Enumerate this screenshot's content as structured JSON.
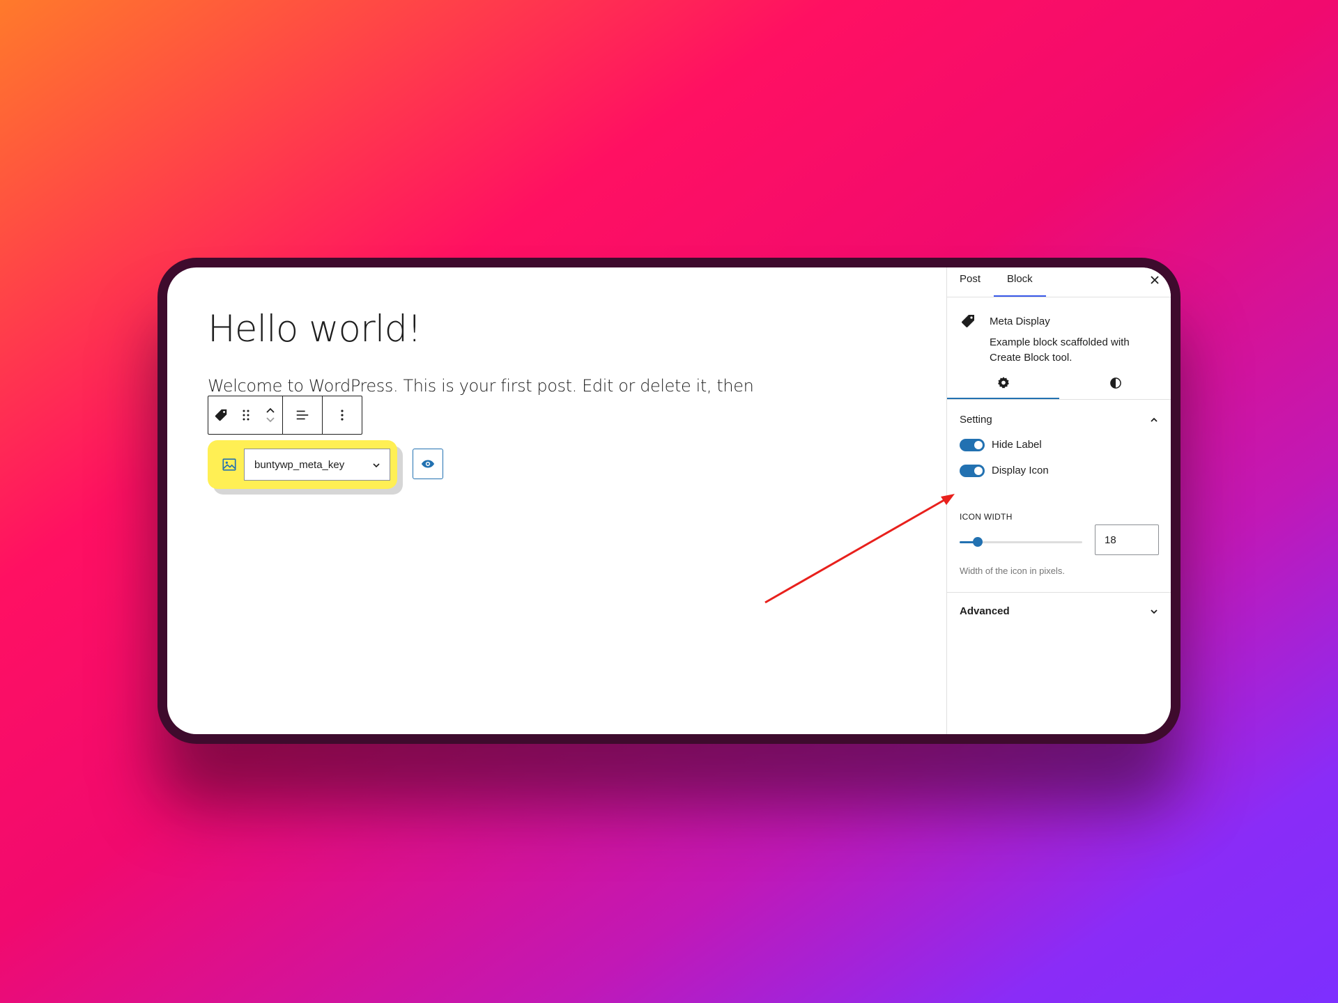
{
  "editor": {
    "post_title": "Hello world!",
    "post_paragraph": "Welcome to WordPress. This is your first post. Edit or delete it, then"
  },
  "toolbar": {
    "block_icon": "tag-icon",
    "drag_icon": "drag-handle-icon",
    "move_up_icon": "chevron-up-icon",
    "move_down_icon": "chevron-down-icon",
    "align_icon": "align-left-icon",
    "more_icon": "more-vertical-icon"
  },
  "block": {
    "image_icon": "image-icon",
    "select_value": "buntywp_meta_key",
    "preview_icon": "eye-icon",
    "highlight_color": "#ffef54"
  },
  "sidebar": {
    "tabs": [
      "Post",
      "Block"
    ],
    "active_tab": "Block",
    "card": {
      "title": "Meta Display",
      "description": "Example block scaffolded with Create Block tool."
    },
    "icon_tabs": [
      "settings-icon",
      "styles-icon"
    ],
    "settings_panel": {
      "title": "Setting",
      "toggles": [
        {
          "label": "Hide Label",
          "checked": true
        },
        {
          "label": "Display Icon",
          "checked": true
        }
      ],
      "icon_width": {
        "label": "ICON WIDTH",
        "value": "18",
        "slider_fraction": 0.15,
        "help": "Width of the icon in pixels."
      }
    },
    "advanced_panel": {
      "title": "Advanced"
    }
  },
  "colors": {
    "accent": "#2271b1",
    "annotation_arrow": "#e8201c"
  }
}
